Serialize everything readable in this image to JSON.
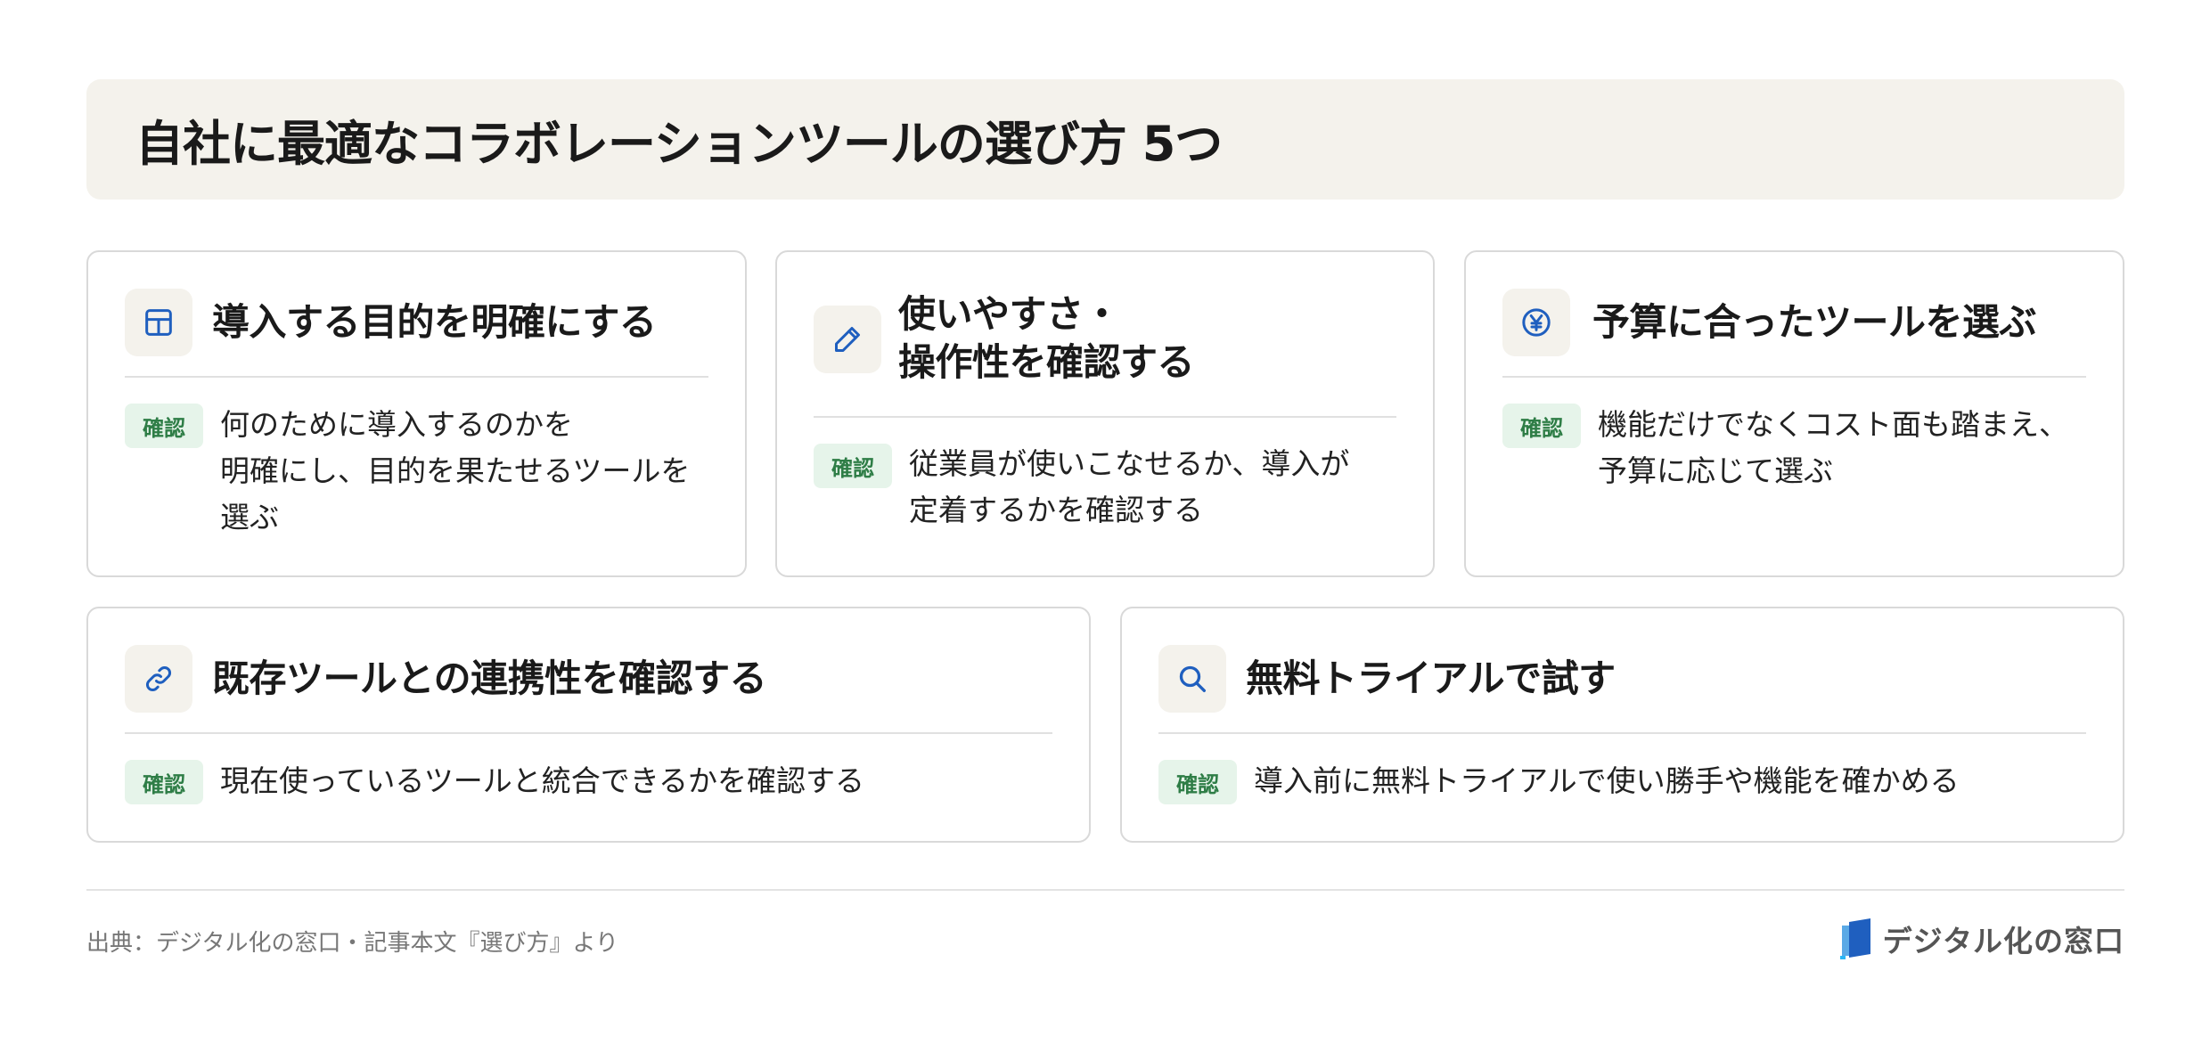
{
  "title": "自社に最適なコラボレーションツールの選び方 5つ",
  "badge_label": "確認",
  "cards": [
    {
      "icon": "table-icon",
      "title_lines": [
        "導入する目的を明確にする"
      ],
      "desc_lines": [
        "何のために導入するのかを",
        "明確にし、目的を果たせるツールを",
        "選ぶ"
      ]
    },
    {
      "icon": "pencil-icon",
      "title_lines": [
        "使いやすさ・",
        "操作性を確認する"
      ],
      "desc_lines": [
        "従業員が使いこなせるか、導入が",
        "定着するかを確認する"
      ]
    },
    {
      "icon": "yen-icon",
      "title_lines": [
        "予算に合ったツールを選ぶ"
      ],
      "desc_lines": [
        "機能だけでなくコスト面も踏まえ、",
        "予算に応じて選ぶ"
      ]
    },
    {
      "icon": "link-icon",
      "title_lines": [
        "既存ツールとの連携性を確認する"
      ],
      "desc_lines": [
        "現在使っているツールと統合できるかを確認する"
      ]
    },
    {
      "icon": "search-icon",
      "title_lines": [
        "無料トライアルで試す"
      ],
      "desc_lines": [
        "導入前に無料トライアルで使い勝手や機能を確かめる"
      ]
    }
  ],
  "footer": {
    "source": "出典：デジタル化の窓口・記事本文『選び方』より",
    "logo_text": "デジタル化の窓口"
  },
  "colors": {
    "accent_blue": "#1f5fbf",
    "badge_bg": "#e6f4ea",
    "badge_text": "#2e7d46",
    "header_bg": "#f4f2ec"
  }
}
